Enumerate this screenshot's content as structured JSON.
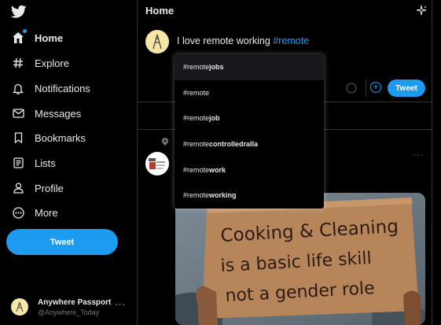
{
  "sidebar": {
    "logo": "twitter-bird-icon",
    "items": [
      {
        "label": "Home",
        "icon": "home-icon",
        "active": true
      },
      {
        "label": "Explore",
        "icon": "hashtag-icon"
      },
      {
        "label": "Notifications",
        "icon": "bell-icon"
      },
      {
        "label": "Messages",
        "icon": "envelope-icon"
      },
      {
        "label": "Bookmarks",
        "icon": "bookmark-icon"
      },
      {
        "label": "Lists",
        "icon": "list-icon"
      },
      {
        "label": "Profile",
        "icon": "person-icon"
      },
      {
        "label": "More",
        "icon": "more-circle-icon"
      }
    ],
    "tweet_label": "Tweet",
    "account": {
      "name": "Anywhere Passport",
      "handle": "@Anywhere_Today",
      "more": "···"
    }
  },
  "header": {
    "title": "Home"
  },
  "composer": {
    "text": "I love remote working ",
    "hashtag": "#remote",
    "tweet_label": "Tweet",
    "add_label": "+"
  },
  "suggestions": [
    {
      "prefix": "#remote",
      "suffix": "jobs"
    },
    {
      "prefix": "#remote",
      "suffix": ""
    },
    {
      "prefix": "#remote",
      "suffix": "job"
    },
    {
      "prefix": "#remote",
      "suffix": "controlledralla"
    },
    {
      "prefix": "#remote",
      "suffix": "work"
    },
    {
      "prefix": "#remote",
      "suffix": "working"
    }
  ],
  "post": {
    "more": "···",
    "image_sign": [
      "Cooking & Cleaning",
      "is a basic life skill",
      "not a gender role"
    ]
  },
  "colors": {
    "accent": "#1d9bf0",
    "background": "#000000",
    "border": "#2f3336"
  }
}
